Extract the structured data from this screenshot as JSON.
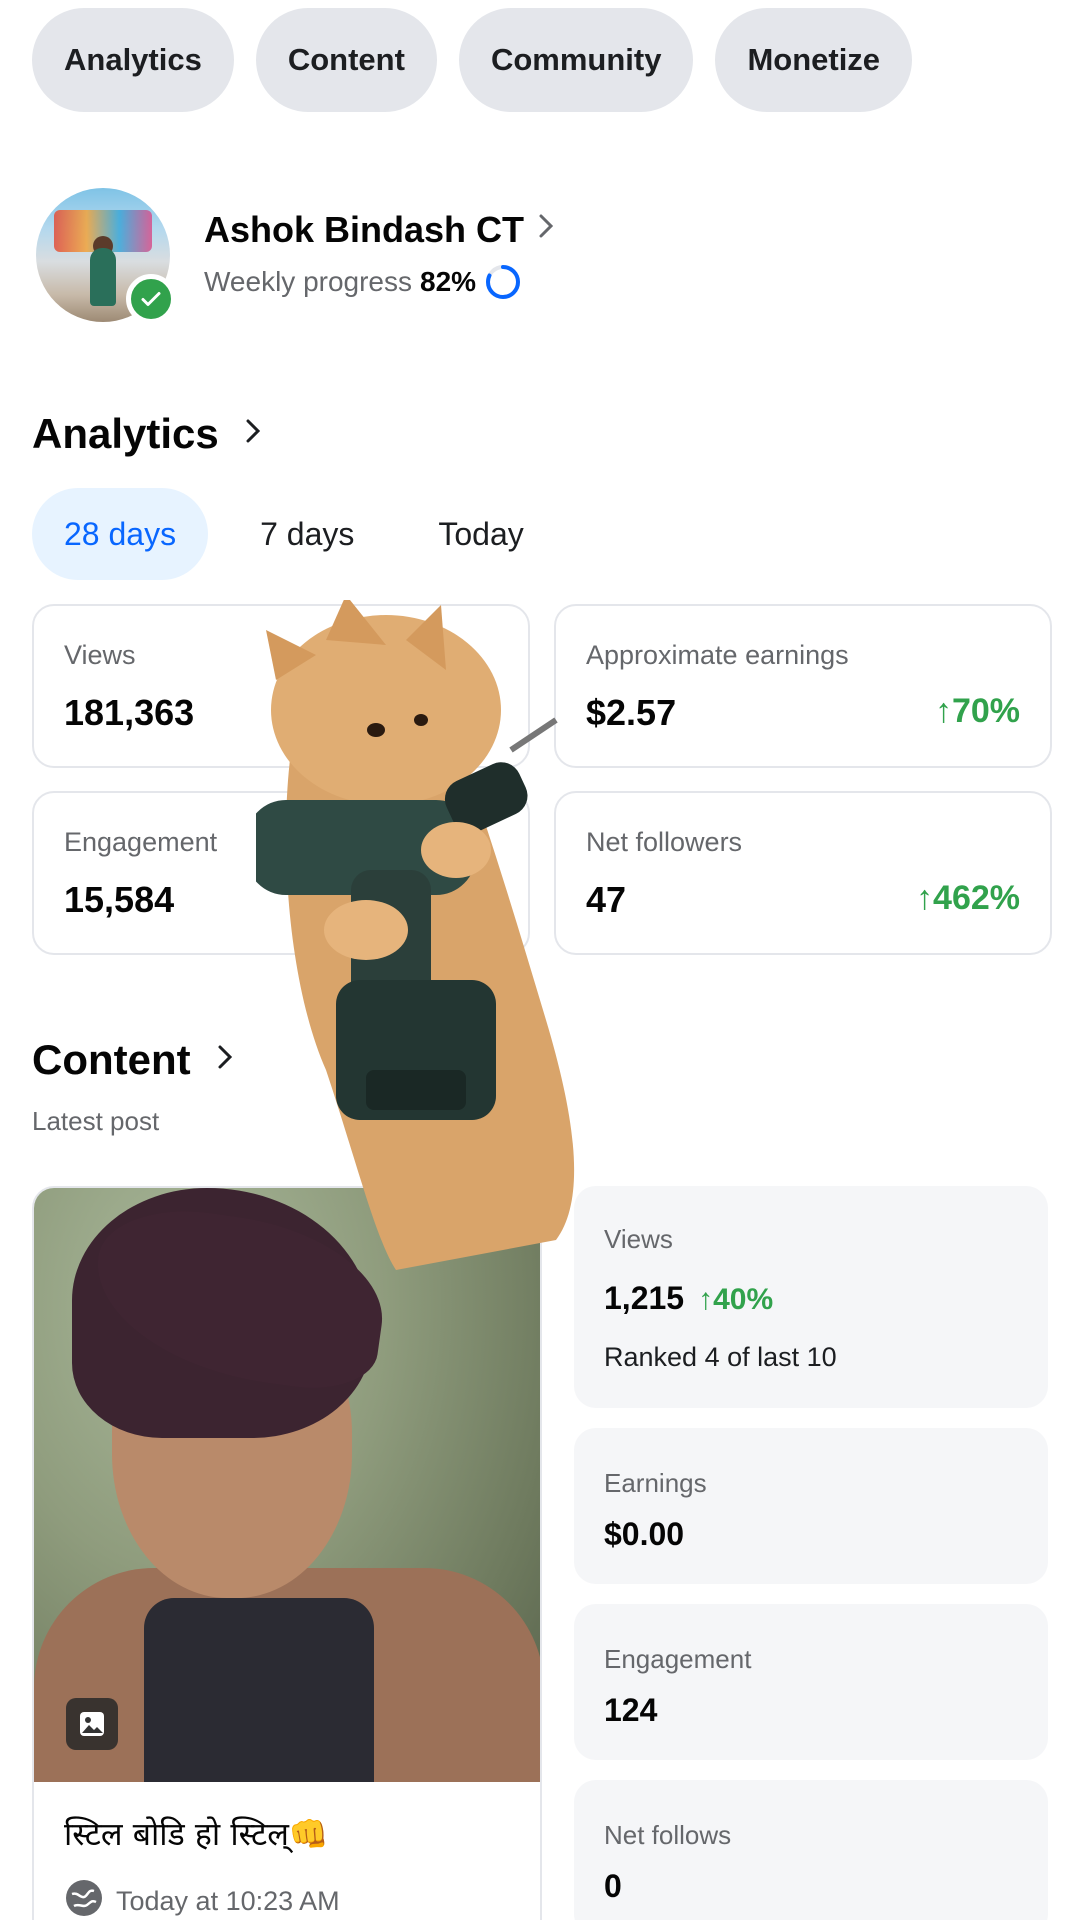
{
  "nav_chips": [
    "Analytics",
    "Content",
    "Community",
    "Monetize"
  ],
  "profile": {
    "name": "Ashok Bindash CT",
    "progress_label": "Weekly progress",
    "progress_value": "82%",
    "progress_fraction": 0.82
  },
  "analytics": {
    "title": "Analytics",
    "ranges": [
      "28 days",
      "7 days",
      "Today"
    ],
    "selected_range": "28 days",
    "cards": [
      {
        "label": "Views",
        "value": "181,363",
        "change": "%"
      },
      {
        "label": "Approximate earnings",
        "value": "$2.57",
        "change": "70%"
      },
      {
        "label": "Engagement",
        "value": "15,584",
        "change": ""
      },
      {
        "label": "Net followers",
        "value": "47",
        "change": "462%"
      }
    ]
  },
  "content": {
    "title": "Content",
    "subtitle": "Latest post",
    "post": {
      "caption": "स्टिल बोडि हो स्टिल्👊",
      "time": "Today at 10:23 AM"
    },
    "stats": {
      "views_label": "Views",
      "views_value": "1,215",
      "views_change": "40%",
      "rank_text": "Ranked 4 of last 10",
      "earnings_label": "Earnings",
      "earnings_value": "$0.00",
      "engagement_label": "Engagement",
      "engagement_value": "124",
      "follows_label": "Net follows",
      "follows_value": "0"
    }
  },
  "colors": {
    "accent_blue": "#0866ff",
    "positive_green": "#31a24c",
    "chip_bg": "#e4e6eb",
    "muted_text": "#65676b"
  },
  "icons": [
    "chevron-right-icon",
    "progress-ring-icon",
    "verified-check-icon",
    "up-arrow-icon",
    "image-type-icon",
    "globe-icon"
  ]
}
